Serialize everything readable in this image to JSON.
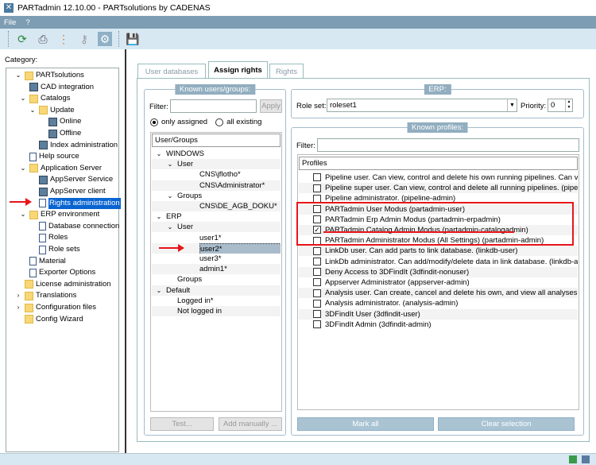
{
  "window": {
    "title": "PARTadmin 12.10.00 - PARTsolutions by CADENAS"
  },
  "menu": [
    "File",
    "?"
  ],
  "toolbar": {
    "icons": [
      "refresh-globe-icon",
      "printer-icon",
      "tree-structure-icon",
      "keys-icon",
      "gear-settings-icon",
      "save-icon"
    ]
  },
  "sidebar": {
    "label": "Category:",
    "items": [
      {
        "label": "PARTsolutions",
        "icon": "folder",
        "level": 0,
        "expanded": true
      },
      {
        "label": "CAD integration",
        "icon": "gear",
        "level": 1
      },
      {
        "label": "Catalogs",
        "icon": "folder",
        "level": 1,
        "expanded": true
      },
      {
        "label": "Update",
        "icon": "folder",
        "level": 2,
        "expanded": true
      },
      {
        "label": "Online",
        "icon": "gear",
        "level": 3
      },
      {
        "label": "Offline",
        "icon": "gear",
        "level": 3
      },
      {
        "label": "Index administration",
        "icon": "tree",
        "level": 2
      },
      {
        "label": "Help source",
        "icon": "doc",
        "level": 1
      },
      {
        "label": "Application Server",
        "icon": "folder",
        "level": 1,
        "expanded": true
      },
      {
        "label": "AppServer Service",
        "icon": "server",
        "level": 2
      },
      {
        "label": "AppServer client",
        "icon": "server",
        "level": 2
      },
      {
        "label": "Rights administration",
        "icon": "doc",
        "level": 2,
        "selected": true
      },
      {
        "label": "ERP environment",
        "icon": "folder",
        "level": 1,
        "expanded": true
      },
      {
        "label": "Database connection",
        "icon": "doc",
        "level": 2
      },
      {
        "label": "Roles",
        "icon": "doc",
        "level": 2
      },
      {
        "label": "Role sets",
        "icon": "doc",
        "level": 2
      },
      {
        "label": "Material",
        "icon": "doc",
        "level": 1
      },
      {
        "label": "Exporter Options",
        "icon": "doc",
        "level": 1
      },
      {
        "label": "License administration",
        "icon": "folder",
        "level": 0
      },
      {
        "label": "Translations",
        "icon": "folder",
        "level": 0,
        "collapsed": true
      },
      {
        "label": "Configuration files",
        "icon": "folder",
        "level": 0,
        "collapsed": true
      },
      {
        "label": "Config Wizard",
        "icon": "folder",
        "level": 0
      }
    ]
  },
  "tabs": [
    {
      "label": "User databases"
    },
    {
      "label": "Assign rights",
      "active": true
    },
    {
      "label": "Rights"
    }
  ],
  "users": {
    "group_label": "Known users/groups:",
    "filter_label": "Filter:",
    "filter_value": "",
    "apply": "Apply",
    "radio_assigned": "only assigned",
    "radio_all": "all existing",
    "column": "User/Groups",
    "rows": [
      {
        "label": "WINDOWS",
        "level": 0,
        "chev": true
      },
      {
        "label": "User",
        "level": 1,
        "chev": true
      },
      {
        "label": "CNS\\jflotho*",
        "level": 2
      },
      {
        "label": "CNS\\Administrator*",
        "level": 2
      },
      {
        "label": "Groups",
        "level": 1,
        "chev": true
      },
      {
        "label": "CNS\\DE_AGB_DOKU*",
        "level": 2
      },
      {
        "label": "ERP",
        "level": 0,
        "chev": true
      },
      {
        "label": "User",
        "level": 1,
        "chev": true
      },
      {
        "label": "user1*",
        "level": 2
      },
      {
        "label": "user2*",
        "level": 2,
        "selected": true
      },
      {
        "label": "user3*",
        "level": 2
      },
      {
        "label": "admin1*",
        "level": 2
      },
      {
        "label": "Groups",
        "level": 1
      },
      {
        "label": "Default",
        "level": 0,
        "chev": true
      },
      {
        "label": "Logged in*",
        "level": 1
      },
      {
        "label": "Not logged in",
        "level": 1
      }
    ],
    "test": "Test...",
    "add_manually": "Add manually ..."
  },
  "erp": {
    "group_label": "ERP:",
    "roleset_label": "Role set:",
    "roleset_value": "roleset1",
    "priority_label": "Priority:",
    "priority_value": "0"
  },
  "profiles": {
    "group_label": "Known profiles:",
    "filter_label": "Filter:",
    "filter_value": "",
    "column": "Profiles",
    "rows": [
      {
        "label": "Pipeline user. Can view, control and delete his own running pipelines. Can vie...",
        "checked": false
      },
      {
        "label": "Pipeline super user. Can view, control and delete all running pipelines. (pipeli...",
        "checked": false
      },
      {
        "label": "Pipeline administrator. (pipeline-admin)",
        "checked": false
      },
      {
        "label": "PARTadmin User Modus (partadmin-user)",
        "checked": false
      },
      {
        "label": "PARTadmin Erp Admin Modus (partadmin-erpadmin)",
        "checked": false
      },
      {
        "label": "PARTadmin Catalog Admin Modus (partadmin-catalogadmin)",
        "checked": true
      },
      {
        "label": "PARTadmin Administrator Modus (All Settings) (partadmin-admin)",
        "checked": false
      },
      {
        "label": "LinkDb user. Can add parts to link database. (linkdb-user)",
        "checked": false
      },
      {
        "label": "LinkDb administrator. Can add/modify/delete data in link database. (linkdb-a...",
        "checked": false
      },
      {
        "label": "Deny Access to 3DFindIt (3dfindit-nonuser)",
        "checked": false
      },
      {
        "label": "Appserver Administrator (appserver-admin)",
        "checked": false
      },
      {
        "label": "Analysis user. Can create, cancel and delete his own, and view all analyses (an...",
        "checked": false
      },
      {
        "label": "Analysis administrator. (analysis-admin)",
        "checked": false
      },
      {
        "label": "3DFindIt User (3dfindit-user)",
        "checked": false
      },
      {
        "label": "3DFindIt Admin (3dfindit-admin)",
        "checked": false
      }
    ],
    "mark_all": "Mark all",
    "clear": "Clear selection"
  },
  "colors": {
    "accent": "#92aec0",
    "highlight": "#e8141a",
    "selection": "#0a64d0"
  }
}
